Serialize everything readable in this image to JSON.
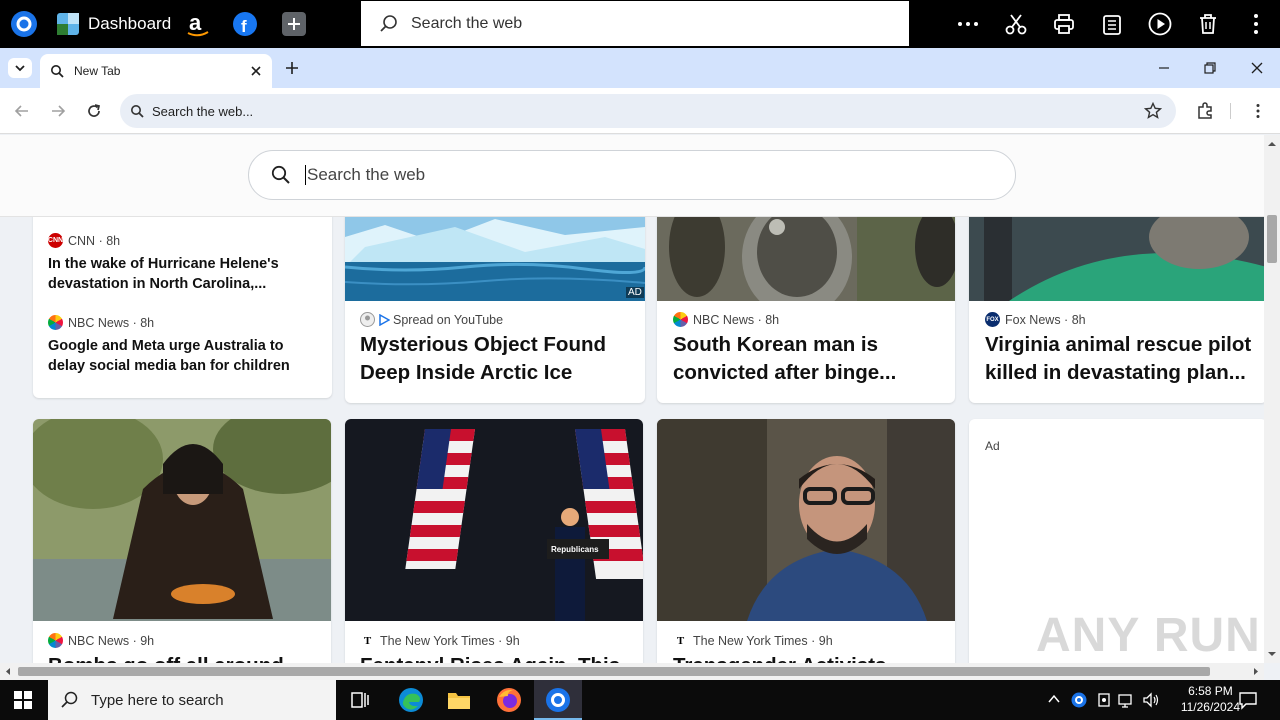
{
  "topbar": {
    "dashboard_label": "Dashboard",
    "search_placeholder": "Search the web",
    "apps": [
      "app-icon",
      "dashboard-icon",
      "amazon-icon",
      "facebook-icon",
      "add-icon"
    ],
    "tools": [
      "more-icon",
      "cut-icon",
      "print-icon",
      "clipboard-icon",
      "play-icon",
      "trash-icon",
      "menu-icon"
    ]
  },
  "browser": {
    "tab_title": "New Tab",
    "omnibox_text": "Search the web...",
    "page_search_placeholder": "Search the web"
  },
  "cards": {
    "col1_item1": {
      "source": "CNN",
      "time": "8h",
      "headline": "In the wake of Hurricane Helene's devastation in North Carolina,..."
    },
    "col1_item2": {
      "source": "NBC News",
      "time": "8h",
      "headline": "Google and Meta urge Australia to delay social media ban for children"
    },
    "card2": {
      "source": "Spread on YouTube",
      "headline": "Mysterious Object Found Deep Inside Arctic Ice",
      "ad_badge": "AD"
    },
    "card3": {
      "source": "NBC News",
      "time": "8h",
      "headline": "South Korean man is convicted after binge..."
    },
    "card4": {
      "source": "Fox News",
      "time": "8h",
      "headline": "Virginia animal rescue pilot killed in devastating plan..."
    },
    "row2_card1": {
      "source": "NBC News",
      "time": "9h",
      "headline": "Bombs go off all around"
    },
    "row2_card2": {
      "source": "The New York Times",
      "time": "9h",
      "headline": "Fentanyl Rises Again. This",
      "podium_sign": "Republicans"
    },
    "row2_card3": {
      "source": "The New York Times",
      "time": "9h",
      "headline": "Transgender Activists"
    },
    "row2_card4": {
      "label": "Ad"
    }
  },
  "taskbar": {
    "search_placeholder": "Type here to search",
    "time": "6:58 PM",
    "date": "11/26/2024"
  },
  "watermark": "ANY RUN",
  "colors": {
    "accent": "#1a73e8",
    "tabstrip": "#d3e3fd",
    "cnn": "#cc0000",
    "nbc": "#6460aa"
  }
}
